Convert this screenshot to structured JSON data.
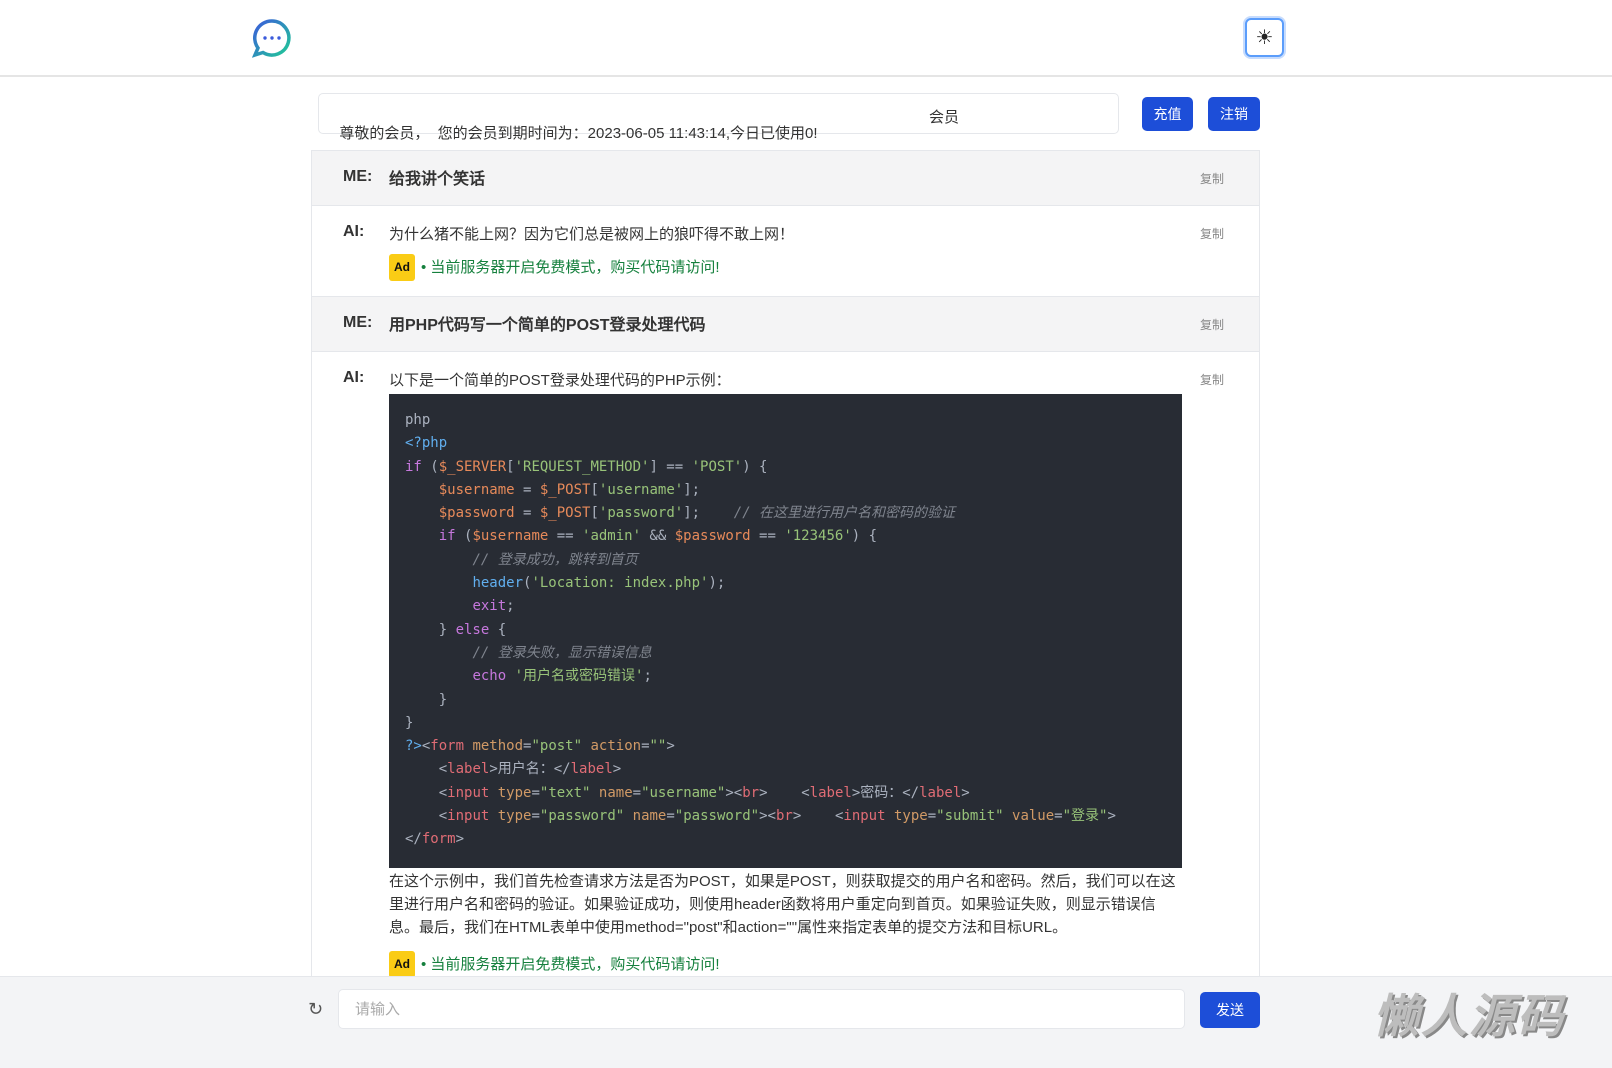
{
  "header": {
    "logo_icon": "chat-bubble-icon",
    "theme_icon": "sun-icon",
    "theme_glyph": "☀"
  },
  "member": {
    "greeting": "尊敬的会员，  您的会员到期时间为：2023-06-05 11:43:14,今日已使用0!",
    "tag": "会员",
    "recharge": "充值",
    "logout": "注销"
  },
  "messages": [
    {
      "role": "ME:",
      "text": "给我讲个笑话",
      "copy": "复制"
    },
    {
      "role": "AI:",
      "text": "为什么猪不能上网？因为它们总是被网上的狼吓得不敢上网！",
      "copy": "复制",
      "ad_badge": "Ad",
      "ad_text": "• 当前服务器开启免费模式，购买代码请访问!"
    },
    {
      "role": "ME:",
      "text": "用PHP代码写一个简单的POST登录处理代码",
      "copy": "复制"
    },
    {
      "role": "AI:",
      "text": "以下是一个简单的POST登录处理代码的PHP示例：",
      "after": "在这个示例中，我们首先检查请求方法是否为POST，如果是POST，则获取提交的用户名和密码。然后，我们可以在这里进行用户名和密码的验证。如果验证成功，则使用header函数将用户重定向到首页。如果验证失败，则显示错误信息。最后，我们在HTML表单中使用method=\"post\"和action=\"\"属性来指定表单的提交方法和目标URL。",
      "copy": "复制",
      "ad_badge": "Ad",
      "ad_text": "• 当前服务器开启免费模式，购买代码请访问!"
    }
  ],
  "code": [
    [
      [
        "p",
        "php"
      ]
    ],
    [
      [
        "k",
        "<?php"
      ]
    ],
    [
      [
        "kw",
        "if"
      ],
      [
        "p",
        " ("
      ],
      [
        "v",
        "$_SERVER"
      ],
      [
        "p",
        "["
      ],
      [
        "s",
        "'REQUEST_METHOD'"
      ],
      [
        "p",
        "] == "
      ],
      [
        "s",
        "'POST'"
      ],
      [
        "p",
        ") {"
      ]
    ],
    [
      [
        "p",
        "    "
      ],
      [
        "v",
        "$username"
      ],
      [
        "p",
        " = "
      ],
      [
        "v",
        "$_POST"
      ],
      [
        "p",
        "["
      ],
      [
        "s",
        "'username'"
      ],
      [
        "p",
        "];"
      ]
    ],
    [
      [
        "p",
        "    "
      ],
      [
        "v",
        "$password"
      ],
      [
        "p",
        " = "
      ],
      [
        "v",
        "$_POST"
      ],
      [
        "p",
        "["
      ],
      [
        "s",
        "'password'"
      ],
      [
        "p",
        "];    "
      ],
      [
        "c",
        "// 在这里进行用户名和密码的验证"
      ]
    ],
    [
      [
        "p",
        "    "
      ],
      [
        "kw",
        "if"
      ],
      [
        "p",
        " ("
      ],
      [
        "v",
        "$username"
      ],
      [
        "p",
        " == "
      ],
      [
        "s",
        "'admin'"
      ],
      [
        "p",
        " && "
      ],
      [
        "v",
        "$password"
      ],
      [
        "p",
        " == "
      ],
      [
        "s",
        "'123456'"
      ],
      [
        "p",
        ") {"
      ]
    ],
    [
      [
        "p",
        "        "
      ],
      [
        "c",
        "// 登录成功，跳转到首页"
      ]
    ],
    [
      [
        "p",
        "        "
      ],
      [
        "k",
        "header"
      ],
      [
        "p",
        "("
      ],
      [
        "s",
        "'Location: index.php'"
      ],
      [
        "p",
        ");"
      ]
    ],
    [
      [
        "p",
        "        "
      ],
      [
        "kw",
        "exit"
      ],
      [
        "p",
        ";"
      ]
    ],
    [
      [
        "p",
        "    } "
      ],
      [
        "kw",
        "else"
      ],
      [
        "p",
        " {"
      ]
    ],
    [
      [
        "p",
        "        "
      ],
      [
        "c",
        "// 登录失败，显示错误信息"
      ]
    ],
    [
      [
        "p",
        "        "
      ],
      [
        "kw",
        "echo"
      ],
      [
        "p",
        " "
      ],
      [
        "s",
        "'用户名或密码错误'"
      ],
      [
        "p",
        ";"
      ]
    ],
    [
      [
        "p",
        "    }"
      ]
    ],
    [
      [
        "p",
        "}"
      ]
    ],
    [
      [
        "k",
        "?>"
      ],
      [
        "p",
        "<"
      ],
      [
        "t",
        "form"
      ],
      [
        "p",
        " "
      ],
      [
        "a",
        "method"
      ],
      [
        "p",
        "="
      ],
      [
        "s",
        "\"post\""
      ],
      [
        "p",
        " "
      ],
      [
        "a",
        "action"
      ],
      [
        "p",
        "="
      ],
      [
        "s",
        "\"\""
      ],
      [
        "p",
        ">"
      ]
    ],
    [
      [
        "p",
        "    <"
      ],
      [
        "t",
        "label"
      ],
      [
        "p",
        ">用户名：</"
      ],
      [
        "t",
        "label"
      ],
      [
        "p",
        ">"
      ]
    ],
    [
      [
        "p",
        "    <"
      ],
      [
        "t",
        "input"
      ],
      [
        "p",
        " "
      ],
      [
        "a",
        "type"
      ],
      [
        "p",
        "="
      ],
      [
        "s",
        "\"text\""
      ],
      [
        "p",
        " "
      ],
      [
        "a",
        "name"
      ],
      [
        "p",
        "="
      ],
      [
        "s",
        "\"username\""
      ],
      [
        "p",
        "><"
      ],
      [
        "t",
        "br"
      ],
      [
        "p",
        ">    <"
      ],
      [
        "t",
        "label"
      ],
      [
        "p",
        ">密码：</"
      ],
      [
        "t",
        "label"
      ],
      [
        "p",
        ">"
      ]
    ],
    [
      [
        "p",
        "    <"
      ],
      [
        "t",
        "input"
      ],
      [
        "p",
        " "
      ],
      [
        "a",
        "type"
      ],
      [
        "p",
        "="
      ],
      [
        "s",
        "\"password\""
      ],
      [
        "p",
        " "
      ],
      [
        "a",
        "name"
      ],
      [
        "p",
        "="
      ],
      [
        "s",
        "\"password\""
      ],
      [
        "p",
        "><"
      ],
      [
        "t",
        "br"
      ],
      [
        "p",
        ">    <"
      ],
      [
        "t",
        "input"
      ],
      [
        "p",
        " "
      ],
      [
        "a",
        "type"
      ],
      [
        "p",
        "="
      ],
      [
        "s",
        "\"submit\""
      ],
      [
        "p",
        " "
      ],
      [
        "a",
        "value"
      ],
      [
        "p",
        "="
      ],
      [
        "s",
        "\"登录\""
      ],
      [
        "p",
        ">"
      ]
    ],
    [
      [
        "p",
        "</"
      ],
      [
        "t",
        "form"
      ],
      [
        "p",
        ">"
      ]
    ]
  ],
  "composer": {
    "refresh_icon": "refresh-icon",
    "placeholder": "请输入",
    "send": "发送"
  },
  "watermark": "懒人源码"
}
